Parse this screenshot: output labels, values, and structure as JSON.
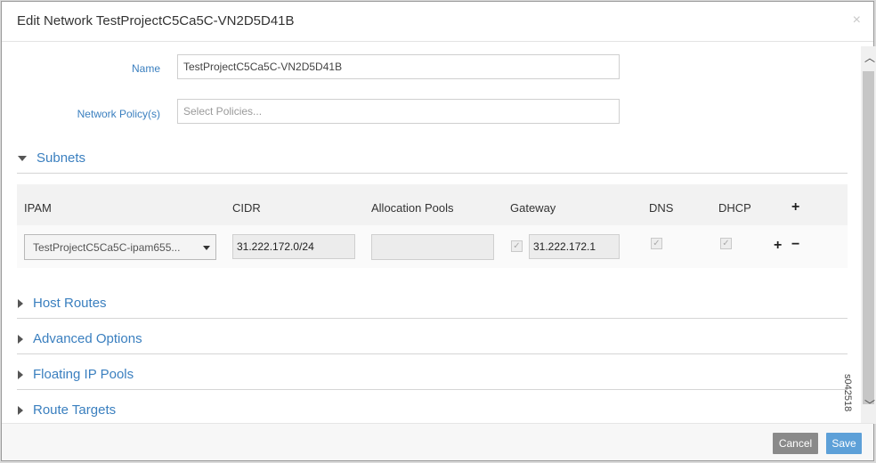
{
  "dialog": {
    "title": "Edit Network TestProjectC5Ca5C-VN2D5D41B",
    "close_symbol": "×"
  },
  "form": {
    "name_label": "Name",
    "name_value": "TestProjectC5Ca5C-VN2D5D41B",
    "policy_label": "Network Policy(s)",
    "policy_placeholder": "Select Policies..."
  },
  "subnets": {
    "title": "Subnets",
    "columns": [
      "IPAM",
      "CIDR",
      "Allocation Pools",
      "Gateway",
      "DNS",
      "DHCP"
    ],
    "row": {
      "ipam": "TestProjectC5Ca5C-ipam655...",
      "cidr": "31.222.172.0/24",
      "allocation_pools": "",
      "gateway": "31.222.172.1",
      "gateway_checked": true,
      "dns_checked": true,
      "dhcp_checked": true
    }
  },
  "sections": [
    "Host Routes",
    "Advanced Options",
    "Floating IP Pools",
    "Route Targets"
  ],
  "footer": {
    "cancel_label": "Cancel",
    "save_label": "Save"
  },
  "watermark": "s042518",
  "colors": {
    "accent": "#3a7fbf",
    "save": "#5da0d8",
    "cancel": "#8a8a8a"
  }
}
